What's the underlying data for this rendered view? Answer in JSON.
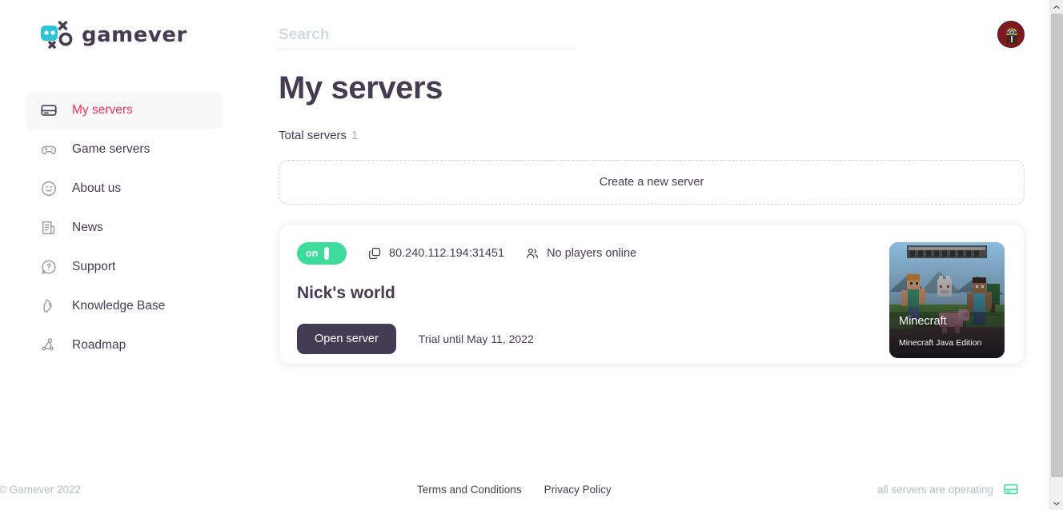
{
  "brand": {
    "name": "gamever",
    "logo_icon": "gamever-logo-icon"
  },
  "sidebar": {
    "items": [
      {
        "label": "My servers",
        "icon": "server-icon",
        "active": true
      },
      {
        "label": "Game servers",
        "icon": "gamepad-icon",
        "active": false
      },
      {
        "label": "About us",
        "icon": "smiley-face-icon",
        "active": false
      },
      {
        "label": "News",
        "icon": "document-icon",
        "active": false
      },
      {
        "label": "Support",
        "icon": "question-chat-icon",
        "active": false
      },
      {
        "label": "Knowledge Base",
        "icon": "book-icon",
        "active": false
      },
      {
        "label": "Roadmap",
        "icon": "network-nodes-icon",
        "active": false
      }
    ]
  },
  "search": {
    "placeholder": "Search",
    "value": "",
    "icon": "search-icon"
  },
  "account": {
    "avatar_icon": "user-avatar-minion"
  },
  "main": {
    "title": "My servers",
    "total_label": "Total servers",
    "total_count": "1",
    "create_label": "Create a new server"
  },
  "server": {
    "power_state": "on",
    "address": "80.240.112.194:31451",
    "copy_icon": "copy-icon",
    "players_icon": "players-icon",
    "players_text": "No players online",
    "name": "Nick's world",
    "open_label": "Open server",
    "trial_text": "Trial until May 11, 2022",
    "game_title": "Minecraft",
    "game_edition": "Minecraft Java Edition"
  },
  "footer": {
    "copyright": "© Gamever 2022",
    "terms_label": "Terms and Conditions",
    "privacy_label": "Privacy Policy",
    "status_text": "all servers are operating",
    "status_icon": "server-status-icon"
  },
  "colors": {
    "accent_pink": "#f5325b",
    "dark_purple": "#453c54",
    "green": "#3ddc9a",
    "cyan": "#2ec4d9",
    "muted": "#9c9aab"
  }
}
